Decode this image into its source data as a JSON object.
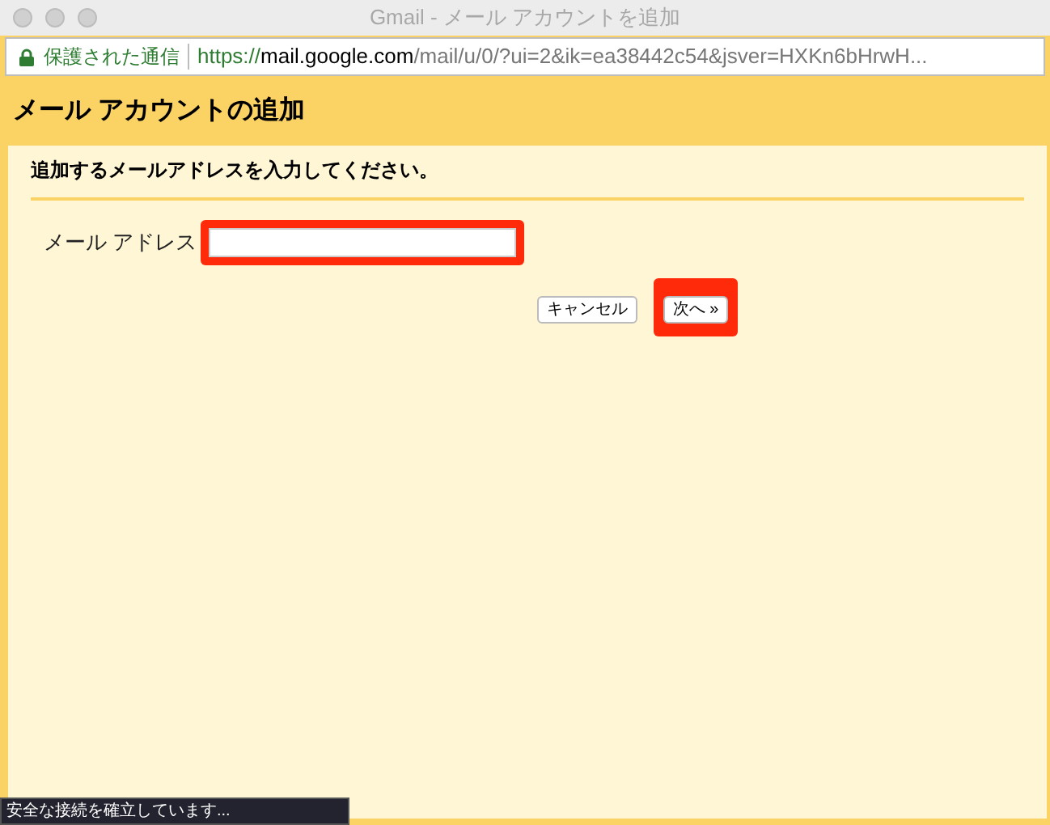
{
  "window": {
    "title": "Gmail - メール アカウントを追加"
  },
  "address_bar": {
    "security_label": "保護された通信",
    "url_scheme": "https://",
    "url_host": "mail.google.com",
    "url_path": "/mail/u/0/?ui=2&ik=ea38442c54&jsver=HXKn6bHrwH..."
  },
  "dialog": {
    "heading": "メール アカウントの追加",
    "instruction": "追加するメールアドレスを入力してください。",
    "field_label": "メール アドレス",
    "buttons": [
      {
        "label": "キャンセル",
        "highlighted": false
      },
      {
        "label": "次へ »",
        "highlighted": true
      }
    ],
    "field_highlighted": true
  },
  "status_bar": "安全な接続を確立しています..."
}
